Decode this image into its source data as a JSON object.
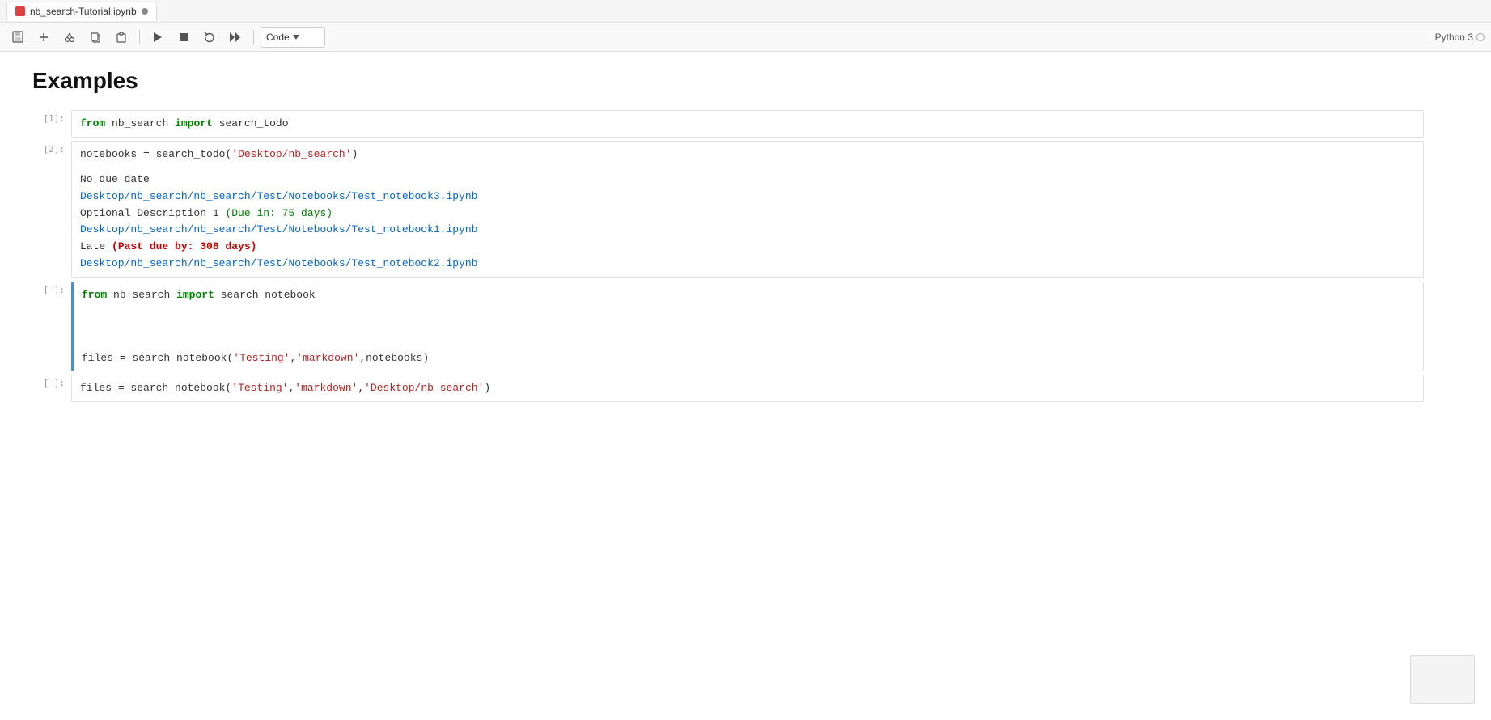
{
  "titlebar": {
    "tab_icon_label": "nb",
    "tab_name": "nb_search-Tutorial.ipynb",
    "tab_modified_dot": true
  },
  "toolbar": {
    "save_label": "💾",
    "add_cell_label": "+",
    "cut_label": "✂",
    "copy_label": "⧉",
    "paste_label": "⧉",
    "run_label": "▶",
    "stop_label": "■",
    "restart_label": "↺",
    "restart_run_label": "⏭",
    "cell_type": "Code",
    "python_label": "Python 3"
  },
  "notebook": {
    "title": "Examples",
    "cells": [
      {
        "label": "[1]:",
        "type": "input",
        "active": false,
        "code_parts": [
          {
            "text": "from",
            "class": "kw-from"
          },
          {
            "text": " nb_search ",
            "class": "kw-module"
          },
          {
            "text": "import",
            "class": "kw-import"
          },
          {
            "text": " search_todo",
            "class": "kw-func"
          }
        ],
        "code_raw": "from nb_search import search_todo"
      },
      {
        "label": "[2]:",
        "type": "input-output",
        "active": false,
        "code_raw": "notebooks = search_todo('Desktop/nb_search')",
        "output_lines": [
          {
            "text": "No due date",
            "class": "out-text",
            "type": "text"
          },
          {
            "text": "Desktop/nb_search/nb_search/Test/Notebooks/Test_notebook3.ipynb",
            "class": "out-link",
            "type": "link"
          },
          {
            "text": "Optional Description 1 ",
            "class": "out-text",
            "type": "text-inline",
            "extra": "(Due in: 75 days)",
            "extra_class": "out-green"
          },
          {
            "text": "Desktop/nb_search/nb_search/Test/Notebooks/Test_notebook1.ipynb",
            "class": "out-link",
            "type": "link"
          },
          {
            "text": "Late ",
            "class": "out-text",
            "type": "text-inline",
            "extra": "(Past due by: 308 days)",
            "extra_class": "out-red"
          },
          {
            "text": "Desktop/nb_search/nb_search/Test/Notebooks/Test_notebook2.ipynb",
            "class": "out-link",
            "type": "link"
          }
        ]
      },
      {
        "label": "[ ]:",
        "type": "input",
        "active": true,
        "code_raw": "from nb_search import search_notebook\n\nfiles = search_notebook('Testing','markdown',notebooks)"
      },
      {
        "label": "[ ]:",
        "type": "input",
        "active": false,
        "code_raw": "files = search_notebook('Testing','markdown','Desktop/nb_search')"
      }
    ]
  }
}
